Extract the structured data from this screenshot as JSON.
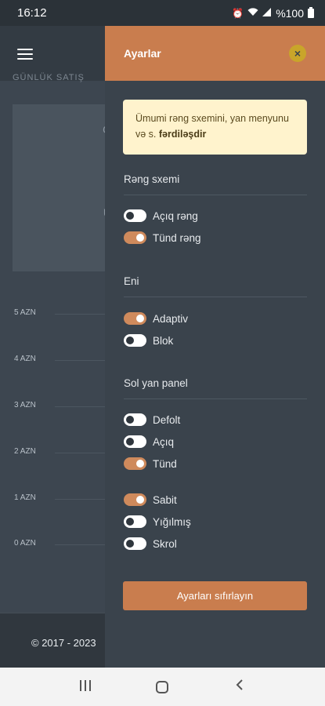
{
  "status_bar": {
    "time": "16:12",
    "battery_text": "%100",
    "icons": [
      "alarm-icon",
      "wifi-icon",
      "signal-icon",
      "battery-icon"
    ]
  },
  "background_page": {
    "subtitle_fragment": "GÜNLÜK SATIŞ",
    "card_chars": [
      "Ö",
      "Ü"
    ],
    "y_labels": [
      "5 AZN",
      "4 AZN",
      "3 AZN",
      "2 AZN",
      "1 AZN",
      "0 AZN"
    ],
    "footer_text": "© 2017 - 2023"
  },
  "panel": {
    "title": "Ayarlar",
    "close_icon": "×",
    "info_text_prefix": "Ümumi rəng sxemini, yan menyunu və s.",
    "info_text_bold": "fərdiləşdir",
    "sections": {
      "color_scheme": {
        "title": "Rəng sxemi",
        "options": [
          {
            "label": "Açıq rəng",
            "on": false
          },
          {
            "label": "Tünd rəng",
            "on": true
          }
        ]
      },
      "width": {
        "title": "Eni",
        "options": [
          {
            "label": "Adaptiv",
            "on": true
          },
          {
            "label": "Blok",
            "on": false
          }
        ]
      },
      "sidebar": {
        "title": "Sol yan panel",
        "options": [
          {
            "label": "Defolt",
            "on": false
          },
          {
            "label": "Açıq",
            "on": false
          },
          {
            "label": "Tünd",
            "on": true
          },
          {
            "label": "Sabit",
            "on": true
          },
          {
            "label": "Yığılmış",
            "on": false
          },
          {
            "label": "Skrol",
            "on": false
          }
        ]
      }
    },
    "reset_button": "Ayarları sıfırlayın"
  },
  "colors": {
    "accent": "#c97d4e",
    "toggle_on": "#cf8a5c",
    "panel_bg": "#3a434c",
    "info_bg": "#fff3cd"
  }
}
